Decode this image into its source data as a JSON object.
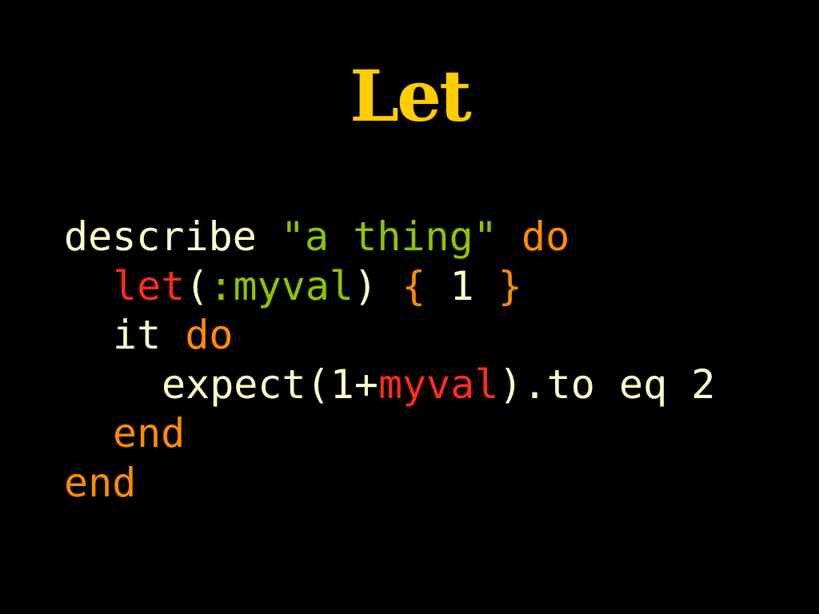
{
  "slide": {
    "title": "Let",
    "code": {
      "line1": {
        "describe": "describe",
        "str": "\"a thing\"",
        "do": "do"
      },
      "line2": {
        "let": "let",
        "open_paren": "(",
        "symbol": ":myval",
        "close_paren": ")",
        "open_brace": "{",
        "value": "1",
        "close_brace": "}"
      },
      "line3": {
        "it": "it",
        "do": "do"
      },
      "line4": {
        "expect": "expect(1+",
        "myval": "myval",
        "rest": ").to eq 2"
      },
      "line5": {
        "end": "end"
      },
      "line6": {
        "end": "end"
      }
    }
  },
  "colors": {
    "background": "#000000",
    "title": "#ffcc00",
    "plain": "#ffffcc",
    "string_symbol": "#8fc400",
    "keyword": "#ff8c00",
    "highlight": "#ff2d1a"
  }
}
